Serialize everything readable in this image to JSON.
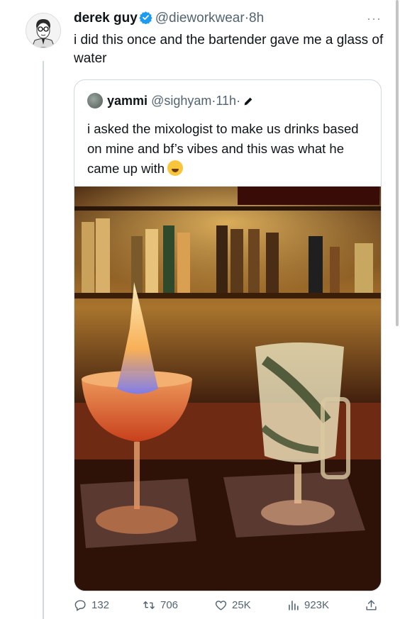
{
  "tweet": {
    "author_name": "derek guy",
    "author_handle": "@dieworkwear",
    "separator": "·",
    "time": "8h",
    "text": "i did this once and the bartender gave me a glass of water",
    "more_label": "···"
  },
  "quoted_tweet": {
    "author_name": "yammi",
    "author_handle": "@sighyam",
    "time": "11h",
    "separator": "·",
    "text": "i asked the mixologist to make us drinks based on mine and bf’s vibes and this was what he came up with"
  },
  "actions": {
    "replies": "132",
    "retweets": "706",
    "likes": "25K",
    "views": "923K"
  },
  "icons": {
    "verified": "verified-badge-icon",
    "more": "more-icon",
    "edit": "pencil-icon",
    "emoji": "crying-face-emoji",
    "reply": "reply-icon",
    "retweet": "retweet-icon",
    "like": "heart-icon",
    "views": "analytics-icon",
    "share": "share-icon"
  },
  "colors": {
    "accent": "#1d9bf0",
    "secondary_text": "#536471",
    "border": "#cfd9de"
  }
}
